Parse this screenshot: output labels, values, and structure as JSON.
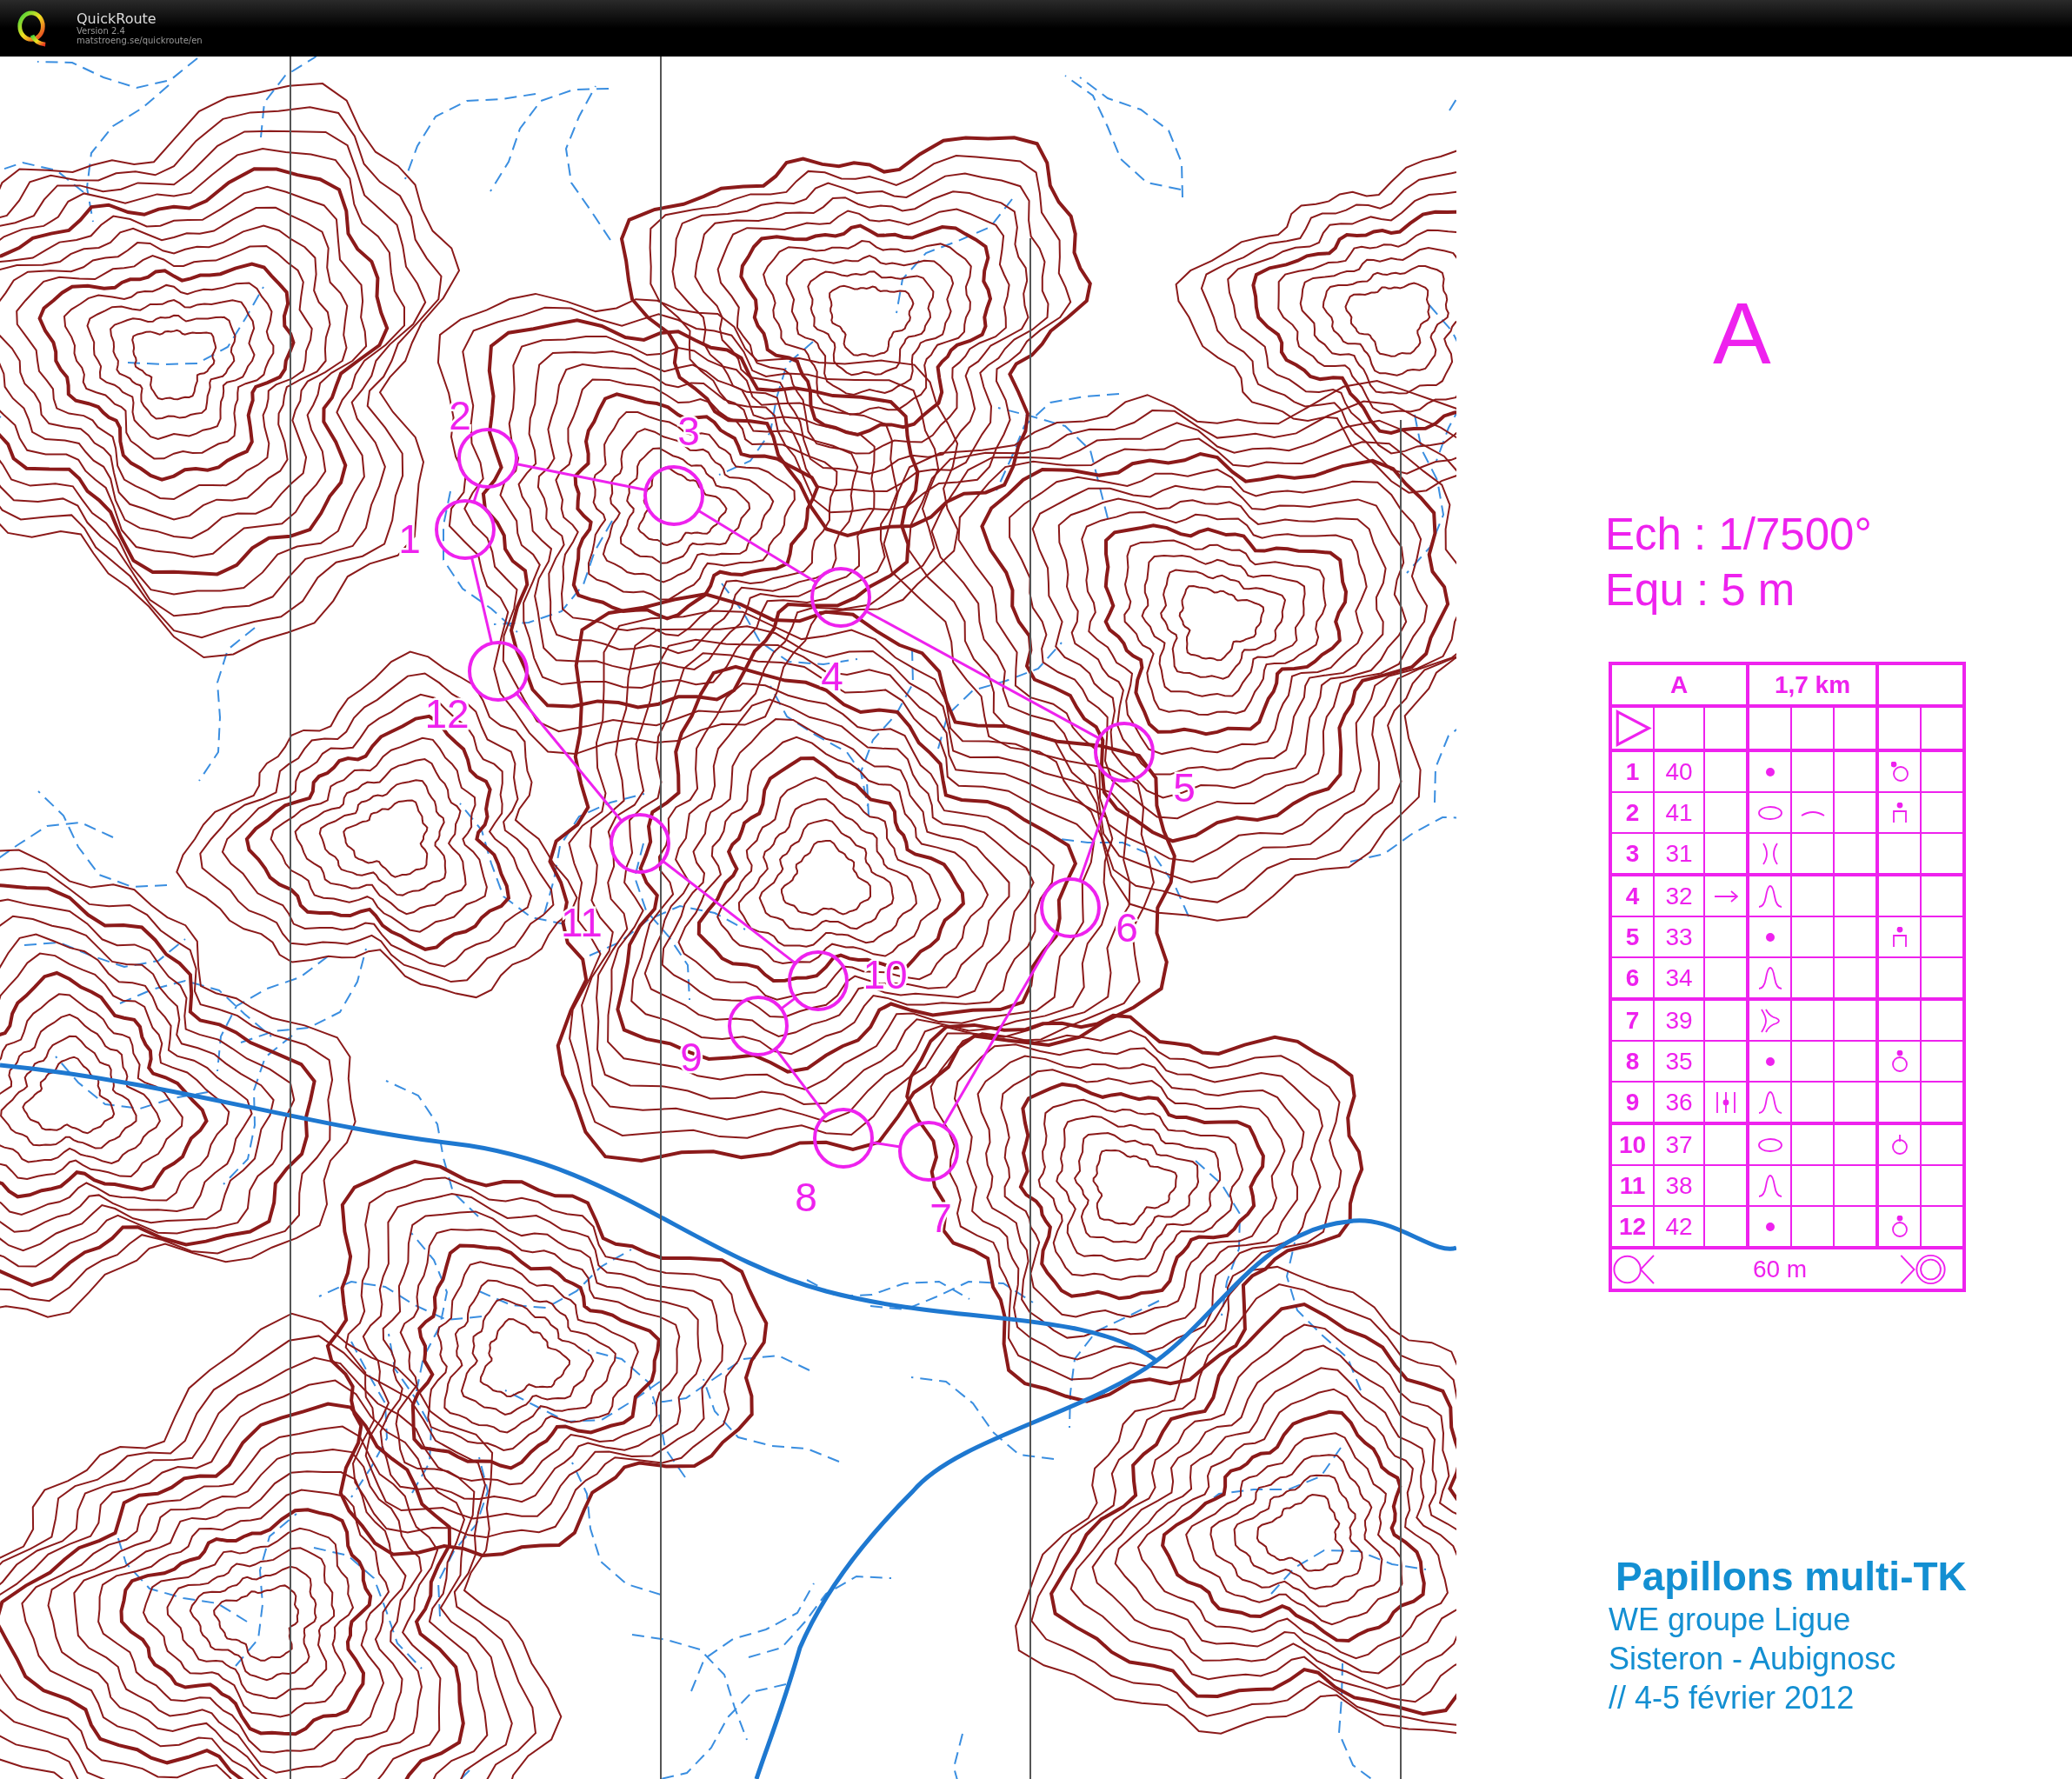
{
  "app": {
    "name": "QuickRoute",
    "version": "Version 2.4",
    "url": "matstroeng.se/quickroute/en"
  },
  "map": {
    "controls": [
      {
        "label": "1"
      },
      {
        "label": "2"
      },
      {
        "label": "3"
      },
      {
        "label": "4"
      },
      {
        "label": "5"
      },
      {
        "label": "6"
      },
      {
        "label": "7"
      },
      {
        "label": "8"
      },
      {
        "label": "9"
      },
      {
        "label": "10"
      },
      {
        "label": "11"
      },
      {
        "label": "12"
      }
    ]
  },
  "legend": {
    "course": "A",
    "scale": "Ech : 1/7500°",
    "contour": "Equ : 5 m"
  },
  "description_sheet": {
    "course": "A",
    "length": "1,7 km",
    "start": {
      "kind": "triangle"
    },
    "controls": [
      {
        "number": "1",
        "code": "40",
        "cells": [
          {
            "kind": "blank"
          },
          {
            "kind": "dot"
          },
          {
            "kind": "blank"
          },
          {
            "kind": "blank"
          },
          {
            "kind": "ringside"
          },
          {
            "kind": "blank"
          }
        ]
      },
      {
        "number": "2",
        "code": "41",
        "cells": [
          {
            "kind": "blank"
          },
          {
            "kind": "ellipse"
          },
          {
            "kind": "arc"
          },
          {
            "kind": "blank"
          },
          {
            "kind": "pillar"
          },
          {
            "kind": "blank"
          }
        ]
      },
      {
        "number": "3",
        "code": "31",
        "cells": [
          {
            "kind": "blank"
          },
          {
            "kind": "narrow"
          },
          {
            "kind": "blank"
          },
          {
            "kind": "blank"
          },
          {
            "kind": "blank"
          },
          {
            "kind": "blank"
          }
        ]
      },
      {
        "number": "4",
        "code": "32",
        "cells": [
          {
            "kind": "arrow"
          },
          {
            "kind": "spur"
          },
          {
            "kind": "blank"
          },
          {
            "kind": "blank"
          },
          {
            "kind": "blank"
          },
          {
            "kind": "blank"
          }
        ]
      },
      {
        "number": "5",
        "code": "33",
        "cells": [
          {
            "kind": "blank"
          },
          {
            "kind": "dot"
          },
          {
            "kind": "blank"
          },
          {
            "kind": "blank"
          },
          {
            "kind": "pillar"
          },
          {
            "kind": "blank"
          }
        ]
      },
      {
        "number": "6",
        "code": "34",
        "cells": [
          {
            "kind": "blank"
          },
          {
            "kind": "spur"
          },
          {
            "kind": "blank"
          },
          {
            "kind": "blank"
          },
          {
            "kind": "blank"
          },
          {
            "kind": "blank"
          }
        ]
      },
      {
        "number": "7",
        "code": "39",
        "cells": [
          {
            "kind": "blank"
          },
          {
            "kind": "fork"
          },
          {
            "kind": "blank"
          },
          {
            "kind": "blank"
          },
          {
            "kind": "blank"
          },
          {
            "kind": "blank"
          }
        ]
      },
      {
        "number": "8",
        "code": "35",
        "cells": [
          {
            "kind": "blank"
          },
          {
            "kind": "dot"
          },
          {
            "kind": "blank"
          },
          {
            "kind": "blank"
          },
          {
            "kind": "ringtop"
          },
          {
            "kind": "blank"
          }
        ]
      },
      {
        "number": "9",
        "code": "36",
        "cells": [
          {
            "kind": "bars"
          },
          {
            "kind": "spur"
          },
          {
            "kind": "blank"
          },
          {
            "kind": "blank"
          },
          {
            "kind": "blank"
          },
          {
            "kind": "blank"
          }
        ]
      },
      {
        "number": "10",
        "code": "37",
        "cells": [
          {
            "kind": "blank"
          },
          {
            "kind": "ellipse"
          },
          {
            "kind": "blank"
          },
          {
            "kind": "blank"
          },
          {
            "kind": "ringstem"
          },
          {
            "kind": "blank"
          }
        ]
      },
      {
        "number": "11",
        "code": "38",
        "cells": [
          {
            "kind": "blank"
          },
          {
            "kind": "spur"
          },
          {
            "kind": "blank"
          },
          {
            "kind": "blank"
          },
          {
            "kind": "blank"
          },
          {
            "kind": "blank"
          }
        ]
      },
      {
        "number": "12",
        "code": "42",
        "cells": [
          {
            "kind": "blank"
          },
          {
            "kind": "dot"
          },
          {
            "kind": "blank"
          },
          {
            "kind": "blank"
          },
          {
            "kind": "ringtop"
          },
          {
            "kind": "blank"
          }
        ]
      }
    ],
    "finish_distance": "60 m"
  },
  "event": {
    "title": "Papillons multi-TK",
    "lines": [
      "WE groupe Ligue",
      "Sisteron - Aubignosc",
      "// 4-5 février 2012"
    ]
  }
}
